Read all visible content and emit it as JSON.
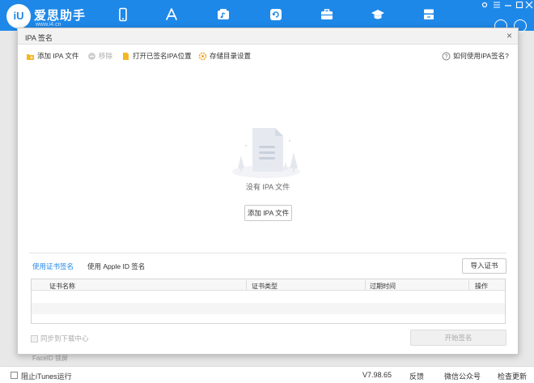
{
  "app": {
    "logo_text": "iU",
    "brand": "爱思助手",
    "brand_url": "www.i4.cn",
    "nav_icons": [
      "phone-icon",
      "appstore-icon",
      "ringtone-icon",
      "refresh-icon",
      "toolbox-icon",
      "graduation-cap-icon",
      "storage-icon"
    ],
    "accent": "#1e88e8"
  },
  "background": {
    "faceid_hint": "FaceID 锁屏",
    "block_itunes": "阻止iTunes运行",
    "version": "V7.98.65",
    "feedback": "反馈",
    "wechat": "微信公众号",
    "check_update": "检查更新"
  },
  "dialog": {
    "title": "IPA 签名",
    "close": "×",
    "toolbar": {
      "add_ipa": "添加 IPA 文件",
      "remove": "移除",
      "open_signed": "打开已签名IPA位置",
      "storage_settings": "存储目录设置",
      "help": "如何使用IPA签名?"
    },
    "empty_text": "没有 IPA 文件",
    "add_button": "添加 IPA 文件",
    "tabs": [
      {
        "label": "使用证书签名",
        "active": true
      },
      {
        "label": "使用 Apple ID 签名",
        "active": false
      }
    ],
    "import_cert": "导入证书",
    "table": {
      "headers": [
        "证书名称",
        "证书类型",
        "过期时间",
        "操作"
      ],
      "rows": []
    },
    "sync_label": "同步到下载中心",
    "start_sign": "开始签名"
  }
}
